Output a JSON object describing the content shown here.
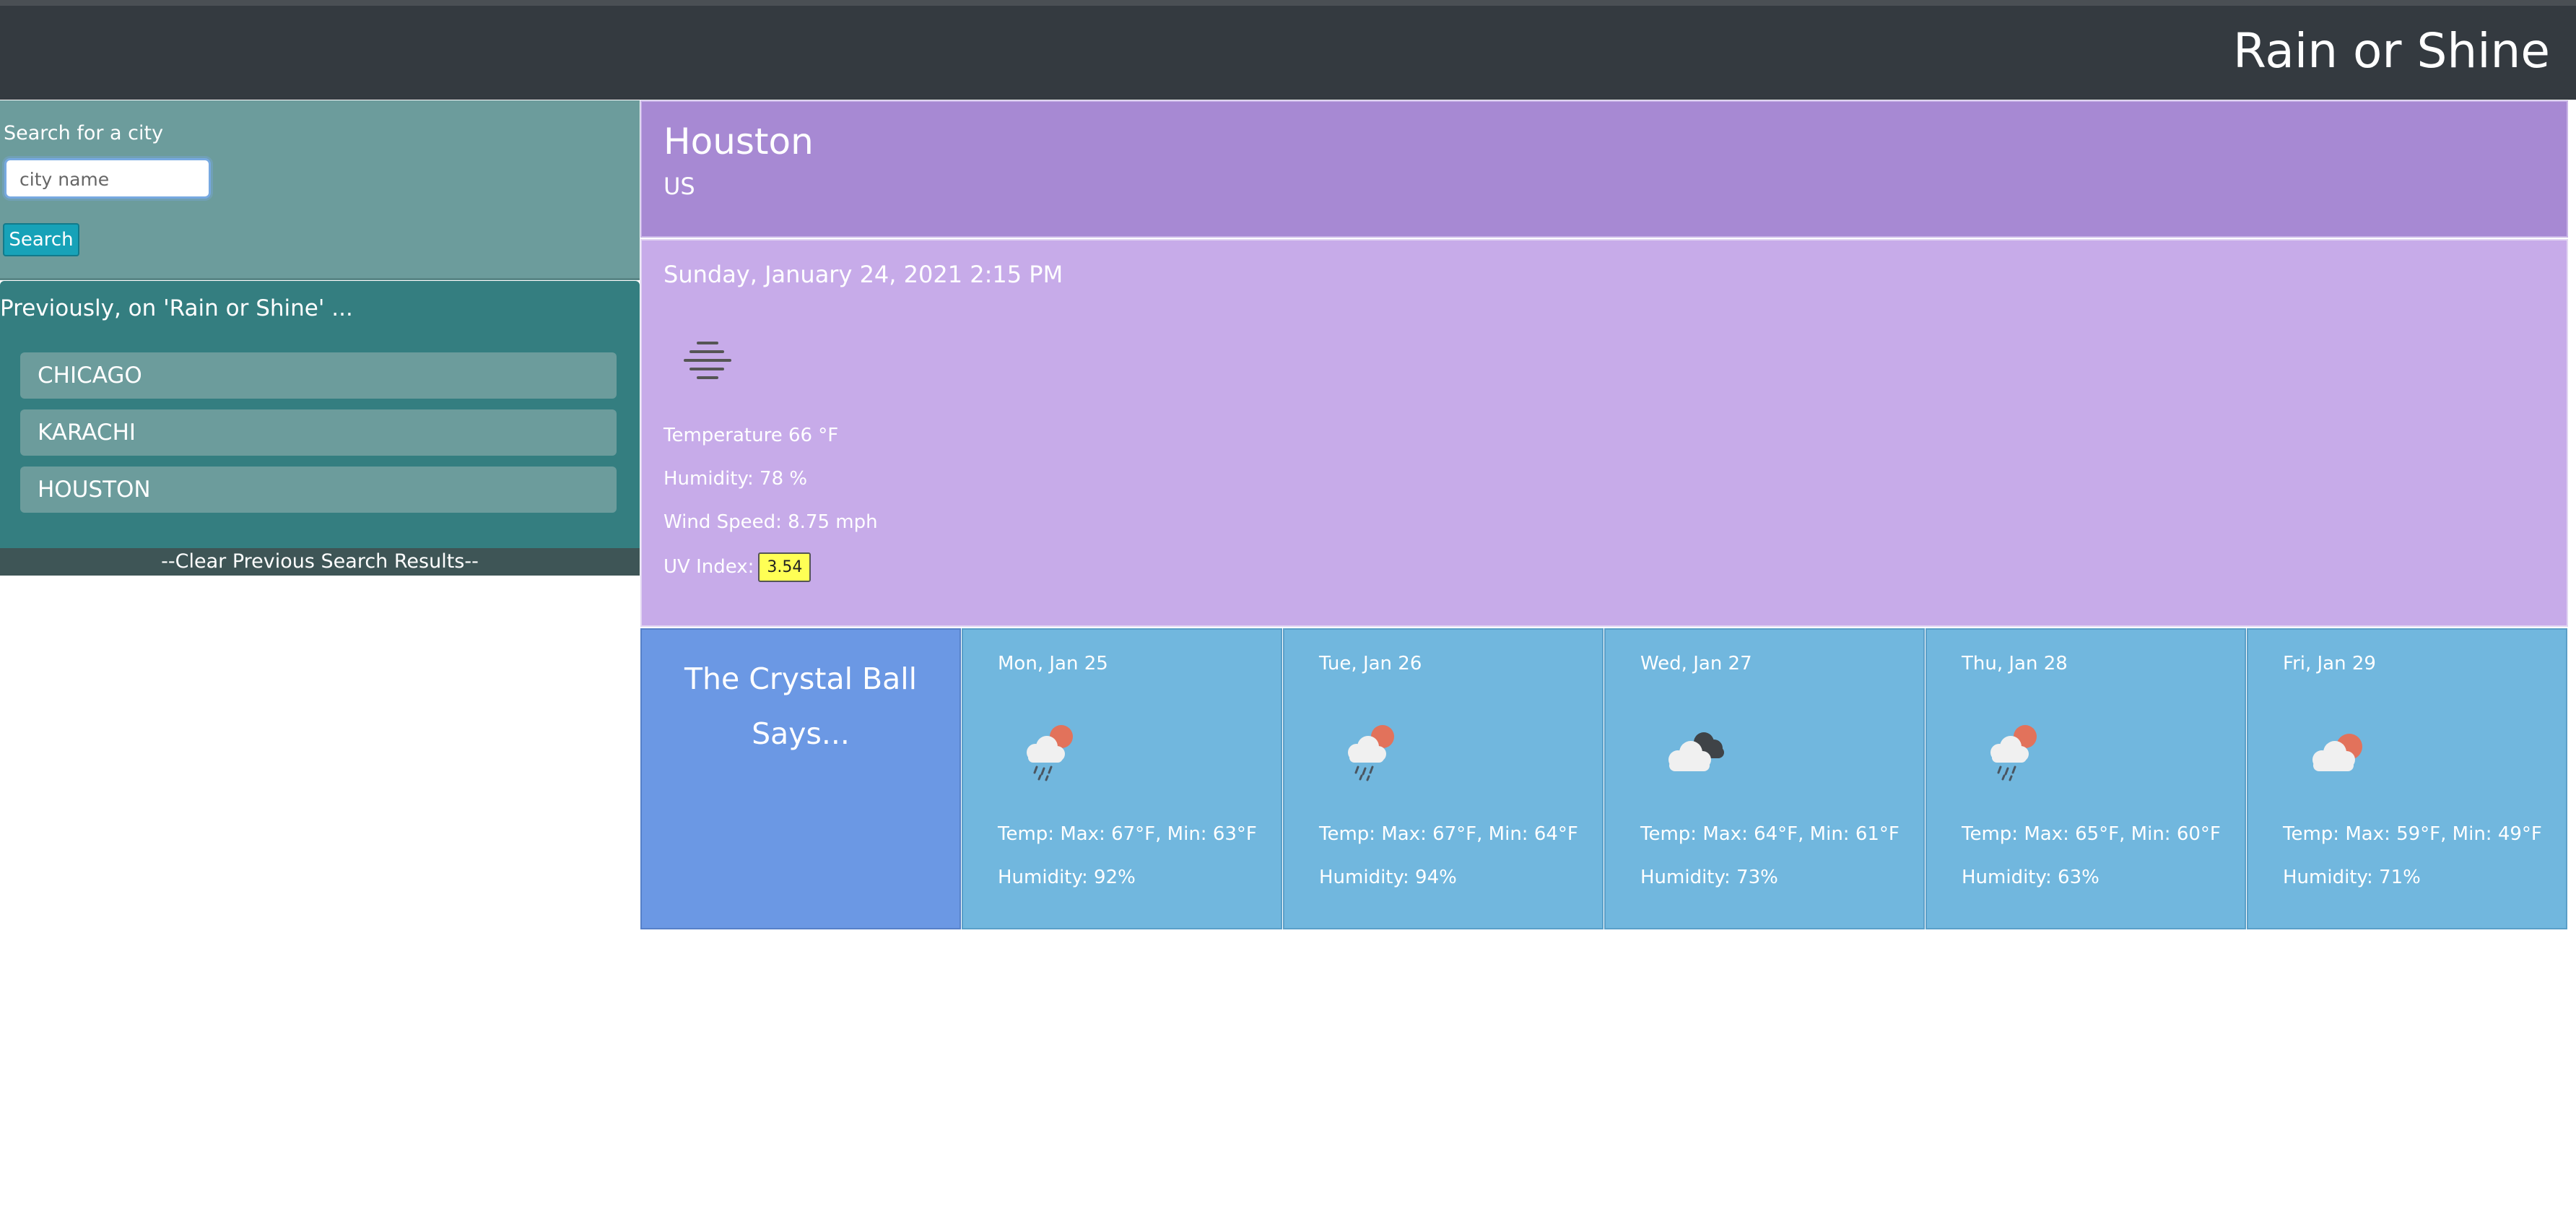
{
  "header": {
    "brand": "Rain or Shine"
  },
  "search": {
    "label": "Search for a city",
    "input_placeholder": "city name",
    "input_value": "",
    "button_label": "Search"
  },
  "history": {
    "title": "Previously, on 'Rain or Shine' ...",
    "items": [
      {
        "label": "CHICAGO"
      },
      {
        "label": "KARACHI"
      },
      {
        "label": "HOUSTON"
      }
    ],
    "clear_label": "--Clear Previous Search Results--"
  },
  "current": {
    "city": "Houston",
    "country": "US",
    "datetime": "Sunday, January 24, 2021 2:15 PM",
    "icon": "mist-icon",
    "temperature": "Temperature 66 °F",
    "humidity": "Humidity: 78 %",
    "wind": "Wind Speed: 8.75 mph",
    "uv_label": "UV Index:",
    "uv_value": "3.54",
    "uv_color": "#ffff55"
  },
  "forecast": {
    "heading": "The Crystal Ball Says...",
    "days": [
      {
        "date": "Mon, Jan 25",
        "icon": "rain-sun-icon",
        "temp": "Temp: Max: 67°F, Min: 63°F",
        "humidity": "Humidity: 92%"
      },
      {
        "date": "Tue, Jan 26",
        "icon": "rain-sun-icon",
        "temp": "Temp: Max: 67°F, Min: 64°F",
        "humidity": "Humidity: 94%"
      },
      {
        "date": "Wed, Jan 27",
        "icon": "broken-clouds-icon",
        "temp": "Temp: Max: 64°F, Min: 61°F",
        "humidity": "Humidity: 73%"
      },
      {
        "date": "Thu, Jan 28",
        "icon": "rain-sun-icon",
        "temp": "Temp: Max: 65°F, Min: 60°F",
        "humidity": "Humidity: 63%"
      },
      {
        "date": "Fri, Jan 29",
        "icon": "cloud-sun-icon",
        "temp": "Temp: Max: 59°F, Min: 49°F",
        "humidity": "Humidity: 71%"
      }
    ]
  },
  "colors": {
    "header_bg": "#343a40",
    "search_bg": "#6c9c9c",
    "history_bg": "#347e80",
    "current_head_bg": "#a789d3",
    "current_body_bg": "#c7abe9",
    "crystal_bg": "#6b98e4",
    "forecast_card_bg": "#71b7de"
  }
}
